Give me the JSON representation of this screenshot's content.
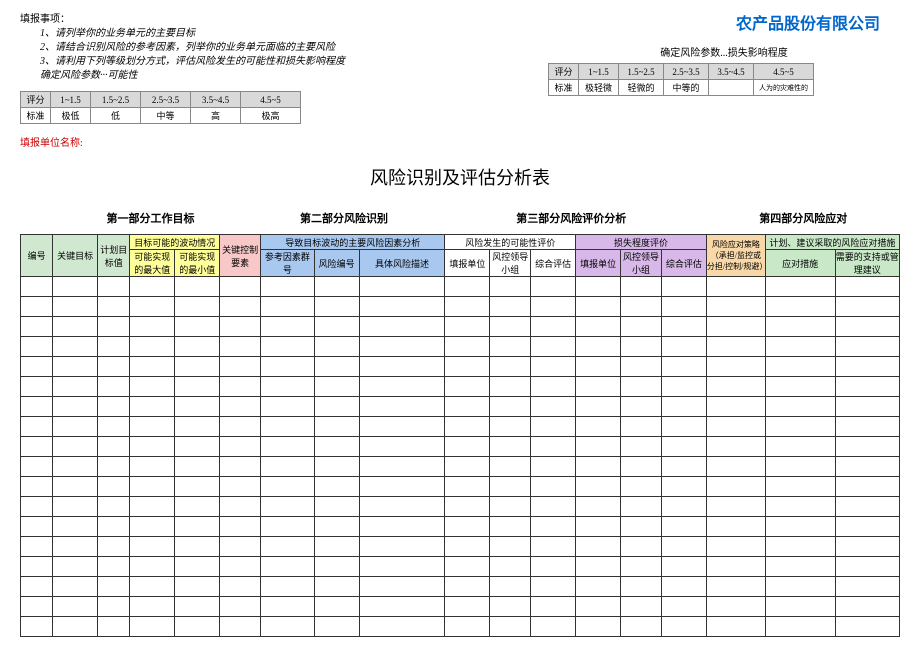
{
  "header": {
    "company": "农产品股份有限公司",
    "instructions_title": "填报事项：",
    "instructions": [
      "1、请列举你的业务单元的主要目标",
      "2、请结合识别风险的参考因素，列举你的业务单元面临的主要风险",
      "3、请利用下列等级划分方式，评估风险发生的可能性和损失影响程度"
    ],
    "param1_intro": "确定风险参数···可能性",
    "param2_title": "确定风险参数...损失影响程度",
    "unit_label": "填报单位名称:"
  },
  "param_table1": {
    "r1": [
      "评分",
      "1~1.5",
      "1.5~2.5",
      "2.5~3.5",
      "3.5~4.5",
      "4.5~5"
    ],
    "r2": [
      "标准",
      "极低",
      "低",
      "中等",
      "高",
      "极高"
    ]
  },
  "param_table2": {
    "r1": [
      "评分",
      "1~1.5",
      "1.5~2.5",
      "2.5~3.5",
      "3.5~4.5",
      "4.5~5"
    ],
    "r2": [
      "标准",
      "极轻微",
      "轻微的",
      "中等的",
      "",
      "人为的灾难性的"
    ]
  },
  "main_title": "风险识别及评估分析表",
  "sections": {
    "s1": "第一部分工作目标",
    "s2": "第二部分风险识别",
    "s3": "第三部分风险评价分析",
    "s4": "第四部分风险应对"
  },
  "cols": {
    "c1": "编号",
    "c2": "关键目标",
    "c3": "计划目标值",
    "c4_top": "目标可能的波动情况",
    "c4a": "可能实现的最大值",
    "c4b": "可能实现的最小值",
    "c5": "关键控制要素",
    "c6_top": "导致目标波动的主要风险因素分析",
    "c6a": "参考因素群号",
    "c6b": "风险编号",
    "c6c": "具体风险描述",
    "c7_top": "风险发生的可能性评价",
    "c7a": "填报单位",
    "c7b": "风控领导小组",
    "c7c": "综合评估",
    "c8_top": "损失程度评价",
    "c8a": "填报单位",
    "c8b": "风控领导小组",
    "c8c": "综合评估",
    "c9": "风险应对策略（承担/监控或分担/控制/规避）",
    "c10_top": "计划、建议采取的风险应对措施",
    "c10a": "应对措施",
    "c10b": "需要的支持或管理建议"
  },
  "data_rows": 18
}
